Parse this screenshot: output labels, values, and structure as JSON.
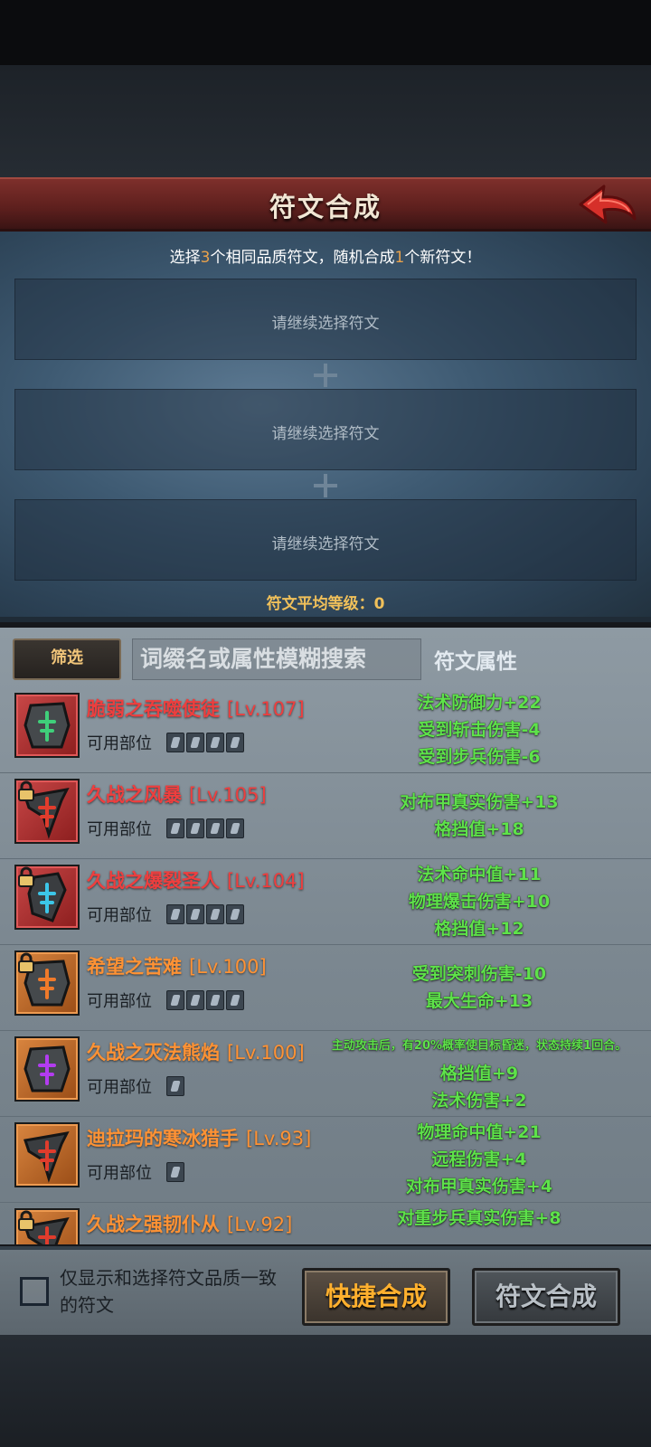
{
  "header": {
    "title": "符文合成"
  },
  "synthesis": {
    "instruction_parts": [
      "选择",
      "3",
      "个相同品质符文，随机合成",
      "1",
      "个新符文！"
    ],
    "slots": [
      "请继续选择符文",
      "请继续选择符文",
      "请继续选择符文"
    ],
    "avg_level_label": "符文平均等级：0"
  },
  "toolbar": {
    "filter_label": "筛选",
    "search_placeholder": "词缀名或属性模糊搜索",
    "attr_title": "符文属性"
  },
  "parts_label": "可用部位",
  "runes": [
    {
      "name": "脆弱之吞噬使徒",
      "level": "[Lv.107]",
      "quality": "red",
      "locked": false,
      "rune_color": "#3fcf7a",
      "parts": 4,
      "stats": [
        "法术防御力+22",
        "受到斩击伤害-4",
        "受到步兵伤害-6"
      ]
    },
    {
      "name": "久战之风暴",
      "level": "[Lv.105]",
      "quality": "red",
      "locked": true,
      "rune_color": "#e03c2c",
      "parts": 4,
      "stats": [
        "对布甲真实伤害+13",
        "格挡值+18"
      ]
    },
    {
      "name": "久战之爆裂圣人",
      "level": "[Lv.104]",
      "quality": "red",
      "locked": true,
      "rune_color": "#3cc6e8",
      "parts": 4,
      "stats": [
        "法术命中值+11",
        "物理爆击伤害+10",
        "格挡值+12"
      ]
    },
    {
      "name": "希望之苦难",
      "level": "[Lv.100]",
      "quality": "orange",
      "locked": true,
      "rune_color": "#f07a2a",
      "parts": 4,
      "stats": [
        "受到突刺伤害-10",
        "最大生命+13"
      ]
    },
    {
      "name": "久战之灭法熊焰",
      "level": "[Lv.100]",
      "quality": "orange",
      "locked": false,
      "rune_color": "#b33cf0",
      "parts": 1,
      "stats": [
        "主动攻击后，有20%概率使目标昏迷，状态持续1回合。",
        "格挡值+9",
        "法术伤害+2"
      ]
    },
    {
      "name": "迪拉玛的寒冰猎手",
      "level": "[Lv.93]",
      "quality": "orange",
      "locked": false,
      "rune_color": "#e03c2c",
      "parts": 1,
      "stats": [
        "物理命中值+21",
        "远程伤害+4",
        "对布甲真实伤害+4"
      ]
    },
    {
      "name": "久战之强韧仆从",
      "level": "[Lv.92]",
      "quality": "orange",
      "locked": true,
      "rune_color": "#e03c2c",
      "parts": 0,
      "stats": [
        "对重步兵真实伤害+8"
      ]
    }
  ],
  "footer": {
    "checkbox_label": "仅显示和选择符文品质一致的符文",
    "quick_button": "快捷合成",
    "synth_button": "符文合成"
  },
  "colors": {
    "quality_red": "#ee3e3e",
    "quality_orange": "#ff9234",
    "stat_green": "#5ee24a",
    "accent_gold": "#f0c05a"
  }
}
